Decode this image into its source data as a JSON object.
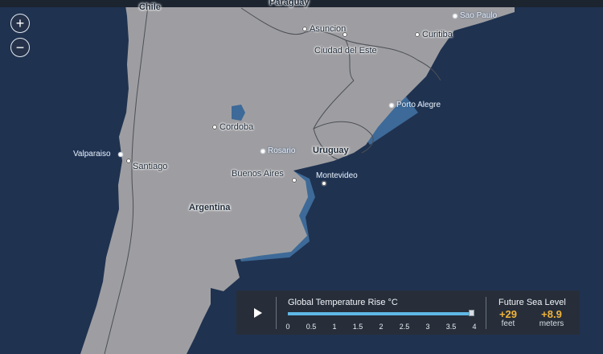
{
  "controls": {
    "zoom_in_label": "+",
    "zoom_out_label": "−"
  },
  "countries": [
    {
      "label": "Chile"
    },
    {
      "label": "Paraguay"
    },
    {
      "label": "Uruguay"
    },
    {
      "label": "Argentina"
    }
  ],
  "cities": [
    {
      "label": "Asuncion"
    },
    {
      "label": "Ciudad del Este"
    },
    {
      "label": "Curitiba"
    },
    {
      "label": "Sao Paulo"
    },
    {
      "label": "Porto Alegre"
    },
    {
      "label": "Cordoba"
    },
    {
      "label": "Rosario"
    },
    {
      "label": "Buenos Aires"
    },
    {
      "label": "Montevideo"
    },
    {
      "label": "Santiago"
    },
    {
      "label": "Valparaiso"
    }
  ],
  "panel": {
    "temp_title": "Global Temperature Rise °C",
    "ticks": [
      "0",
      "0.5",
      "1",
      "1.5",
      "2",
      "2.5",
      "3",
      "3.5",
      "4"
    ],
    "temp_value_c": 4,
    "temp_max_c": 4,
    "sea_title": "Future Sea Level",
    "feet_value": "+29",
    "feet_label": "feet",
    "meters_value": "+8.9",
    "meters_label": "meters"
  },
  "colors": {
    "ocean": "#1f3250",
    "land": "#9e9ea2",
    "flooded": "#3d6a98",
    "accent": "#f0b43a",
    "slider": "#5fb8e6"
  }
}
